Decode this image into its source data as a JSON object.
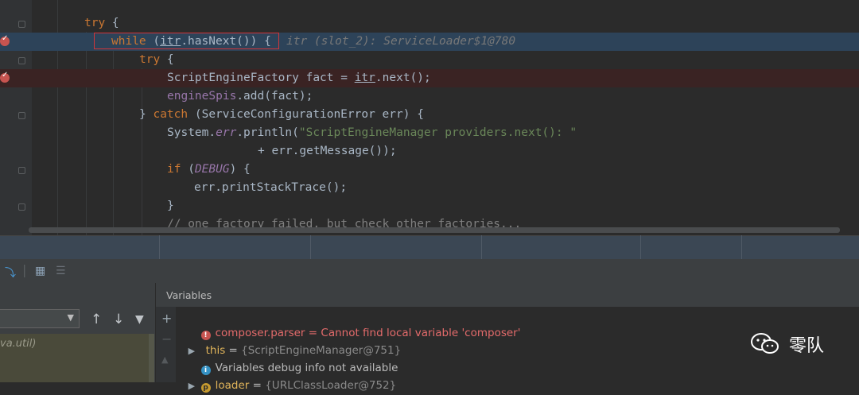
{
  "editor": {
    "lines": {
      "l1": {
        "kw": "try",
        "rest": " {"
      },
      "l2": {
        "kw": "while",
        "open": " (",
        "itr": "itr",
        "call": ".hasNext()) {",
        "hint": "itr (slot_2): ServiceLoader$1@780"
      },
      "l3": {
        "kw": "try",
        "rest": " {"
      },
      "l4": {
        "type": "ScriptEngineFactory fact = ",
        "itr": "itr",
        "call": ".next();"
      },
      "l5": {
        "fld": "engineSpis",
        "rest": ".add(fact);"
      },
      "l6": {
        "pre": "} ",
        "kw": "catch",
        "rest": " (ServiceConfigurationError err) {"
      },
      "l7": {
        "pre": "System.",
        "fld": "err",
        "mid": ".println(",
        "str": "\"ScriptEngineManager providers.next(): \""
      },
      "l8": {
        "text": "+ err.getMessage());"
      },
      "l9": {
        "kw": "if",
        "open": " (",
        "fld": "DEBUG",
        "rest": ") {"
      },
      "l10": {
        "text": "err.printStackTrace();"
      },
      "l11": {
        "text": "}"
      },
      "l12": {
        "cmt": "// one factory failed, but check other factories..."
      }
    }
  },
  "toolbar": {
    "icons": [
      "step-into-icon",
      "table-icon",
      "settings-icon"
    ]
  },
  "frames": {
    "partial_frame": "va.util)"
  },
  "variables": {
    "header": "Variables",
    "rows": [
      {
        "name": "composer.parser",
        "eq": " = ",
        "value": "Cannot find local variable 'composer'",
        "icon": "error-icon"
      },
      {
        "name": "this",
        "eq": " = ",
        "value": "{ScriptEngineManager@751}",
        "icon": "expand-icon"
      },
      {
        "text": "Variables debug info not available",
        "icon": "info-icon"
      },
      {
        "name": "loader",
        "eq": " = ",
        "value": "{URLClassLoader@752}",
        "icon": "param-icon"
      }
    ]
  },
  "watermark": {
    "text": "零队"
  },
  "colors": {
    "accent_exec_line": "#2d4359",
    "breakpoint": "#c75450",
    "keyword": "#cc7832",
    "field": "#9876aa",
    "string": "#6a8759"
  }
}
